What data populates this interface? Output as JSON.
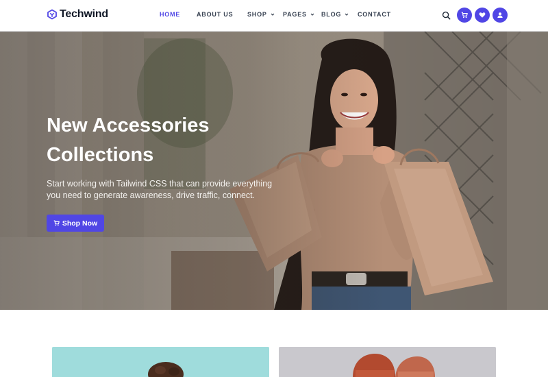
{
  "brand": {
    "name": "Techwind",
    "logo_icon": "cube-logo-icon",
    "accent": "#5046e5"
  },
  "nav": {
    "items": [
      {
        "label": "HOME",
        "active": true,
        "dropdown": false
      },
      {
        "label": "ABOUT US",
        "active": false,
        "dropdown": false
      },
      {
        "label": "SHOP",
        "active": false,
        "dropdown": true
      },
      {
        "label": "PAGES",
        "active": false,
        "dropdown": true
      },
      {
        "label": "BLOG",
        "active": false,
        "dropdown": true
      },
      {
        "label": "CONTACT",
        "active": false,
        "dropdown": false
      }
    ]
  },
  "header_icons": [
    "search-icon",
    "cart-icon",
    "heart-icon",
    "user-icon"
  ],
  "hero": {
    "title_line1": "New Accessories",
    "title_line2": "Collections",
    "subtitle": "Start working with Tailwind CSS that can provide everything you need to generate awareness, drive traffic, connect.",
    "cta_label": "Shop Now",
    "cta_icon": "cart-icon"
  },
  "colors": {
    "primary": "#5046e5",
    "text_dark": "#111827",
    "nav_text": "#374151"
  }
}
